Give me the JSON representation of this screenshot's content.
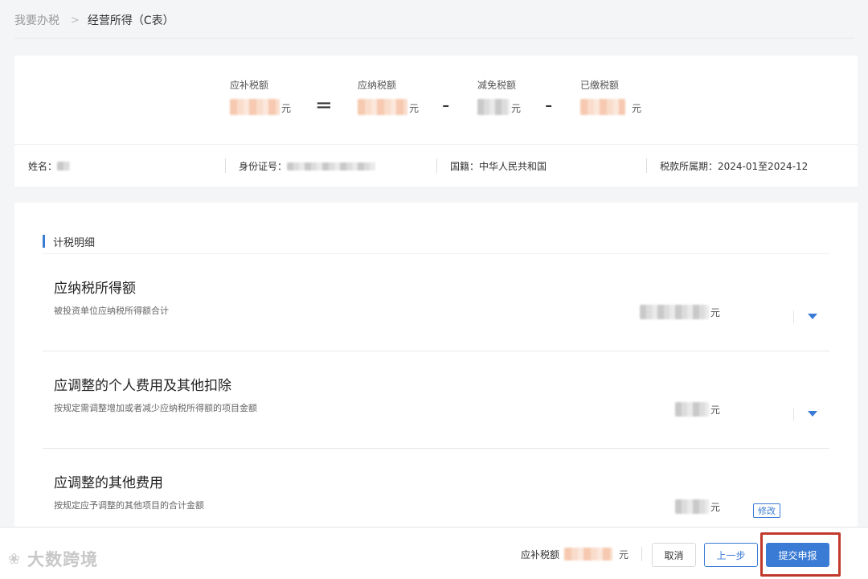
{
  "breadcrumb": {
    "parent": "我要办税",
    "separator": ">",
    "current": "经营所得（C表）"
  },
  "summary": {
    "payable_label": "应补税额",
    "due_label": "应纳税额",
    "relief_label": "减免税额",
    "paid_label": "已缴税额",
    "unit": "元",
    "equals": "=",
    "minus": "-"
  },
  "info": {
    "name_label": "姓名：",
    "id_label": "身份证号：",
    "nationality_label": "国籍：",
    "nationality_value": "中华人民共和国",
    "period_label": "税款所属期：",
    "period_value": "2024-01至2024-12"
  },
  "detail": {
    "section_title": "计税明细",
    "rows": [
      {
        "title": "应纳税所得额",
        "desc": "被投资单位应纳税所得额合计",
        "unit": "元"
      },
      {
        "title": "应调整的个人费用及其他扣除",
        "desc": "按规定需调整增加或者减少应纳税所得额的项目金额",
        "unit": "元"
      },
      {
        "title": "应调整的其他费用",
        "desc": "按规定应予调整的其他项目的合计金额",
        "unit": "元",
        "action": "修改"
      }
    ]
  },
  "footer": {
    "total_label": "应补税额",
    "unit": "元",
    "cancel": "取消",
    "prev": "上一步",
    "submit": "提交申报",
    "watermark": "大数跨境"
  },
  "colors": {
    "accent": "#3a7bd5",
    "highlight": "#c0392b"
  }
}
